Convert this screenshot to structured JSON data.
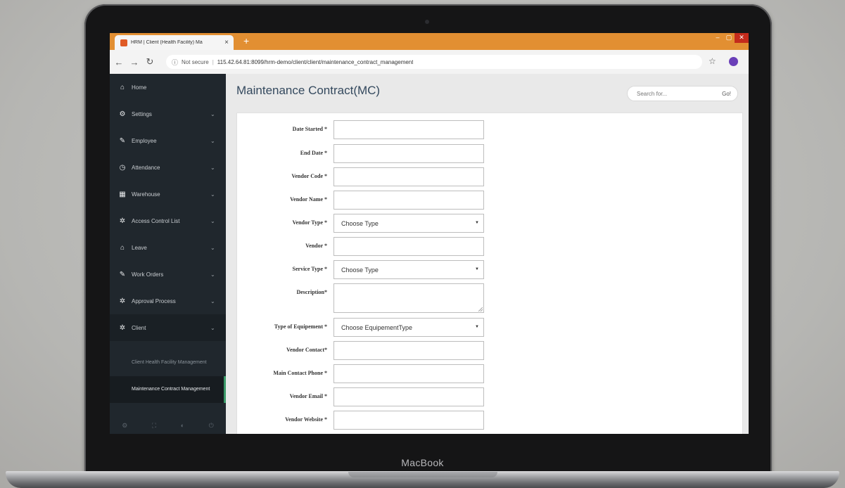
{
  "browser": {
    "tab_title": "HRM | Client (Health Facility) Ma",
    "tab_close": "×",
    "new_tab": "+",
    "security": "Not secure",
    "url_divider": "|",
    "url": "115.42.64.81:8099/hrm-demo/client/client/maintenance_contract_management"
  },
  "sidebar": {
    "items": [
      {
        "label": "Home",
        "icon": "home-icon",
        "glyph": "⌂",
        "chev": ""
      },
      {
        "label": "Settings",
        "icon": "sitemap-icon",
        "glyph": "⚙",
        "chev": "⌄"
      },
      {
        "label": "Employee",
        "icon": "edit-icon",
        "glyph": "✎",
        "chev": "⌄"
      },
      {
        "label": "Attendance",
        "icon": "clock-icon",
        "glyph": "◷",
        "chev": "⌄"
      },
      {
        "label": "Warehouse",
        "icon": "building-icon",
        "glyph": "▦",
        "chev": "⌄"
      },
      {
        "label": "Access Control List",
        "icon": "gear-icon",
        "glyph": "✲",
        "chev": "⌄"
      },
      {
        "label": "Leave",
        "icon": "home-icon",
        "glyph": "⌂",
        "chev": "⌄"
      },
      {
        "label": "Work Orders",
        "icon": "edit-icon",
        "glyph": "✎",
        "chev": "⌄"
      },
      {
        "label": "Approval Process",
        "icon": "gear-icon",
        "glyph": "✲",
        "chev": "⌄"
      },
      {
        "label": "Client",
        "icon": "gear-icon",
        "glyph": "✲",
        "chev": "⌄"
      }
    ],
    "sub_items": [
      {
        "label": "Client Health Facility Management"
      },
      {
        "label": "Maintenance Contract Management"
      }
    ]
  },
  "main": {
    "title": "Maintenance Contract(MC)",
    "search_placeholder": "Search for...",
    "search_go": "Go!"
  },
  "form": {
    "fields": [
      {
        "label": "Date Started *",
        "type": "text",
        "value": ""
      },
      {
        "label": "End Date *",
        "type": "text",
        "value": ""
      },
      {
        "label": "Vendor Code *",
        "type": "text",
        "value": ""
      },
      {
        "label": "Vendor Name *",
        "type": "text",
        "value": ""
      },
      {
        "label": "Vendor Type *",
        "type": "select",
        "value": "Choose Type"
      },
      {
        "label": "Vendor *",
        "type": "text",
        "value": ""
      },
      {
        "label": "Service Type *",
        "type": "select",
        "value": "Choose Type"
      },
      {
        "label": "Description*",
        "type": "textarea",
        "value": ""
      },
      {
        "label": "Type of Equipement *",
        "type": "select",
        "value": "Choose EquipementType"
      },
      {
        "label": "Vendor Contact*",
        "type": "text",
        "value": ""
      },
      {
        "label": "Main Contact Phone *",
        "type": "text",
        "value": ""
      },
      {
        "label": "Vendor Email *",
        "type": "text",
        "value": ""
      },
      {
        "label": "Vendor Website *",
        "type": "text",
        "value": ""
      }
    ]
  },
  "device": {
    "brand": "MacBook"
  },
  "colors": {
    "tabbar": "#e28f32",
    "sidebar": "#20272d",
    "active_accent": "#3a9a69"
  }
}
